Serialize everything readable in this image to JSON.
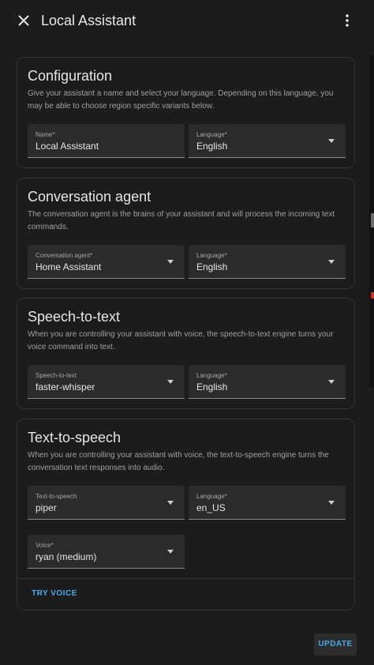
{
  "header": {
    "title": "Local Assistant"
  },
  "configuration": {
    "title": "Configuration",
    "description": "Give your assistant a name and select your language. Depending on this language, you may be able to choose region specific variants below.",
    "name_label": "Name*",
    "name_value": "Local Assistant",
    "language_label": "Language*",
    "language_value": "English"
  },
  "conversation_agent": {
    "title": "Conversation agent",
    "description": "The conversation agent is the brains of your assistant and will process the incoming text commands.",
    "agent_label": "Conversation agent*",
    "agent_value": "Home Assistant",
    "language_label": "Language*",
    "language_value": "English"
  },
  "speech_to_text": {
    "title": "Speech-to-text",
    "description": "When you are controlling your assistant with voice, the speech-to-text engine turns your voice command into text.",
    "engine_label": "Speech-to-text",
    "engine_value": "faster-whisper",
    "language_label": "Language*",
    "language_value": "English"
  },
  "text_to_speech": {
    "title": "Text-to-speech",
    "description": "When you are controlling your assistant with voice, the text-to-speech engine turns the conversation text responses into audio.",
    "engine_label": "Text-to-speech",
    "engine_value": "piper",
    "language_label": "Language*",
    "language_value": "en_US",
    "voice_label": "Voice*",
    "voice_value": "ryan (medium)",
    "try_voice_label": "TRY VOICE"
  },
  "footer": {
    "update_label": "UPDATE"
  },
  "colors": {
    "background": "#1c1c1c",
    "field": "#2b2b2b",
    "accent": "#4aa8e8"
  }
}
